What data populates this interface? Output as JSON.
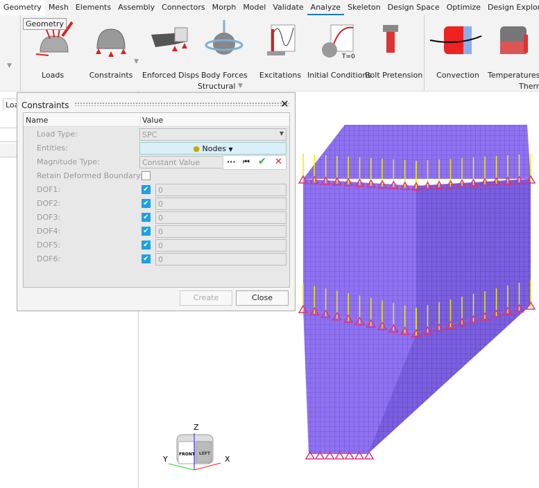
{
  "menu": [
    "Geometry",
    "Mesh",
    "Elements",
    "Assembly",
    "Connectors",
    "Morph",
    "Model",
    "Validate",
    "Analyze",
    "Skeleton",
    "Design Space",
    "Optimize",
    "Design Explorer"
  ],
  "active_menu": "Analyze",
  "tooltip": "Geometry",
  "ribbon": {
    "tools": [
      "Loads",
      "Constraints",
      "Enforced Disps",
      "Body Forces",
      "Excitations",
      "Initial Conditions",
      "Bolt Pretension",
      "Convection",
      "Temperatures"
    ],
    "group_structural": "Structural",
    "group_thermal": "Therr",
    "t0": "T=0"
  },
  "left_tab": "Loa",
  "dialog": {
    "title": "Constraints",
    "col_name": "Name",
    "col_value": "Value",
    "load_type_label": "Load Type:",
    "load_type": "SPC",
    "entities_label": "Entities:",
    "entities": "Nodes",
    "magnitude_label": "Magnitude Type:",
    "magnitude": "Constant Value",
    "retain_label": "Retain Deformed Boundary:",
    "dofs": [
      {
        "label": "DOF1:",
        "value": "0"
      },
      {
        "label": "DOF2:",
        "value": "0"
      },
      {
        "label": "DOF3:",
        "value": "0"
      },
      {
        "label": "DOF4:",
        "value": "0"
      },
      {
        "label": "DOF5:",
        "value": "0"
      },
      {
        "label": "DOF6:",
        "value": "0"
      }
    ],
    "more": "···",
    "create": "Create",
    "close": "Close"
  },
  "triad": {
    "z": "Z",
    "x": "X",
    "y": "Y",
    "front": "FRONT",
    "left": "LEFT"
  },
  "colors": {
    "accent": "#1a7bb0",
    "mesh": "#8a6cf0",
    "constraint": "#e0307a"
  }
}
